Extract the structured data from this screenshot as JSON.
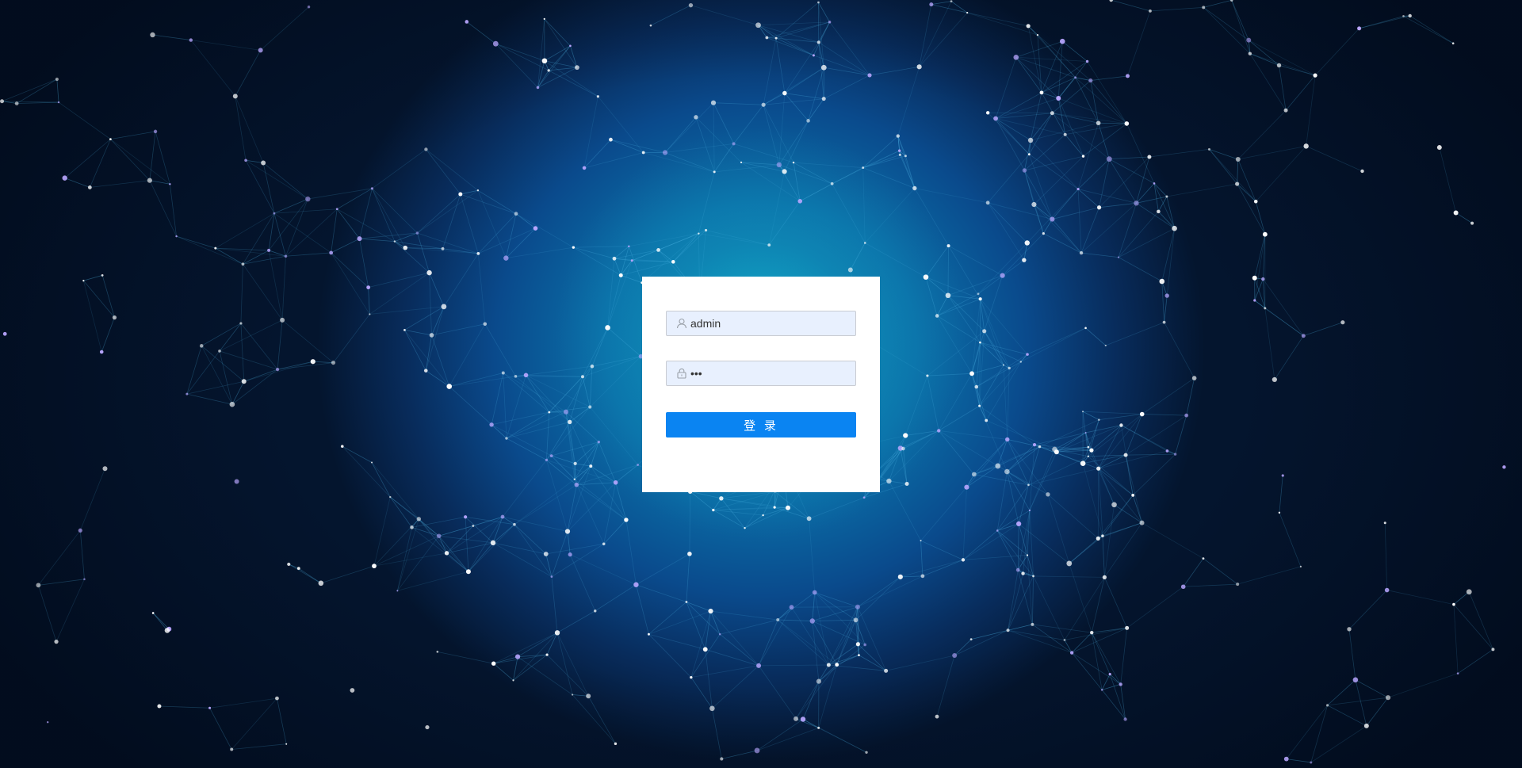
{
  "login": {
    "username": {
      "icon": "user-icon",
      "value": "admin"
    },
    "password": {
      "icon": "lock-icon",
      "value": "abc"
    },
    "submit_label": "登 录"
  },
  "background": {
    "description_icon": "particle-network-background",
    "colors": {
      "center": "#0e8fb8",
      "edge": "#04152e",
      "node": "#ffffff",
      "node_purple": "#b9a6ff",
      "line": "#4fb6e6"
    }
  },
  "colors": {
    "button": "#0a84f2",
    "input_bg": "#e8f0fe",
    "input_border": "#c9ccd3",
    "card": "#ffffff"
  }
}
